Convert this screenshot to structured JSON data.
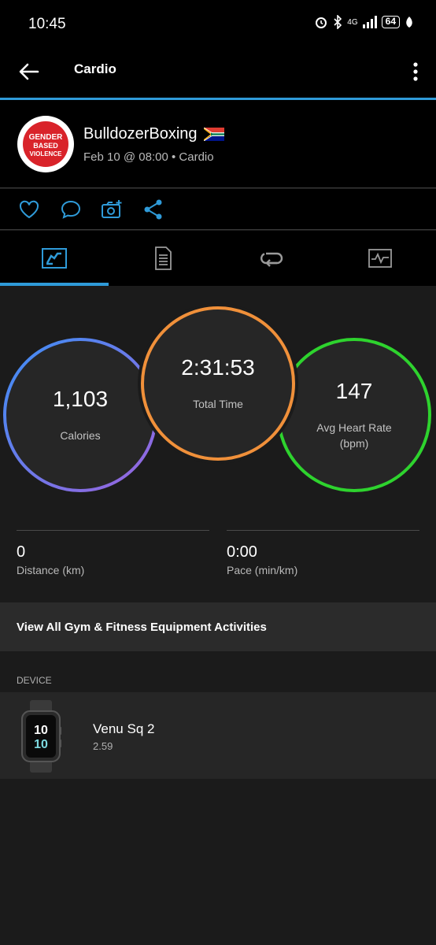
{
  "status_bar": {
    "time": "10:45",
    "network": "4G",
    "battery": "64"
  },
  "app_bar": {
    "title": "Cardio"
  },
  "header": {
    "user_name": "BulldozerBoxing",
    "date": "Feb 10 @ 08:00",
    "activity_type": "Cardio",
    "avatar_logo_text": "GENDER BASED VIOLENCE"
  },
  "actions": [
    "heart-icon",
    "comment-icon",
    "camera-add-icon",
    "share-icon"
  ],
  "tabs": [
    "summary-icon",
    "details-icon",
    "laps-icon",
    "chart-icon"
  ],
  "colors": {
    "accent": "#2f9bd9",
    "calories_ring": "#6b6cf0",
    "time_ring": "#f0903a",
    "heart_ring": "#2ed32e"
  },
  "circles": {
    "calories": {
      "value": "1,103",
      "label": "Calories"
    },
    "total_time": {
      "value": "2:31:53",
      "label": "Total Time"
    },
    "heart_rate": {
      "value": "147",
      "label": "Avg Heart Rate",
      "unit": "(bpm)"
    }
  },
  "stats": {
    "distance": {
      "value": "0",
      "label": "Distance (km)"
    },
    "pace": {
      "value": "0:00",
      "label": "Pace (min/km)"
    }
  },
  "view_all_label": "View All Gym & Fitness Equipment Activities",
  "device_section": {
    "label": "DEVICE",
    "name": "Venu Sq 2",
    "version": "2.59",
    "watch_face": "10"
  }
}
